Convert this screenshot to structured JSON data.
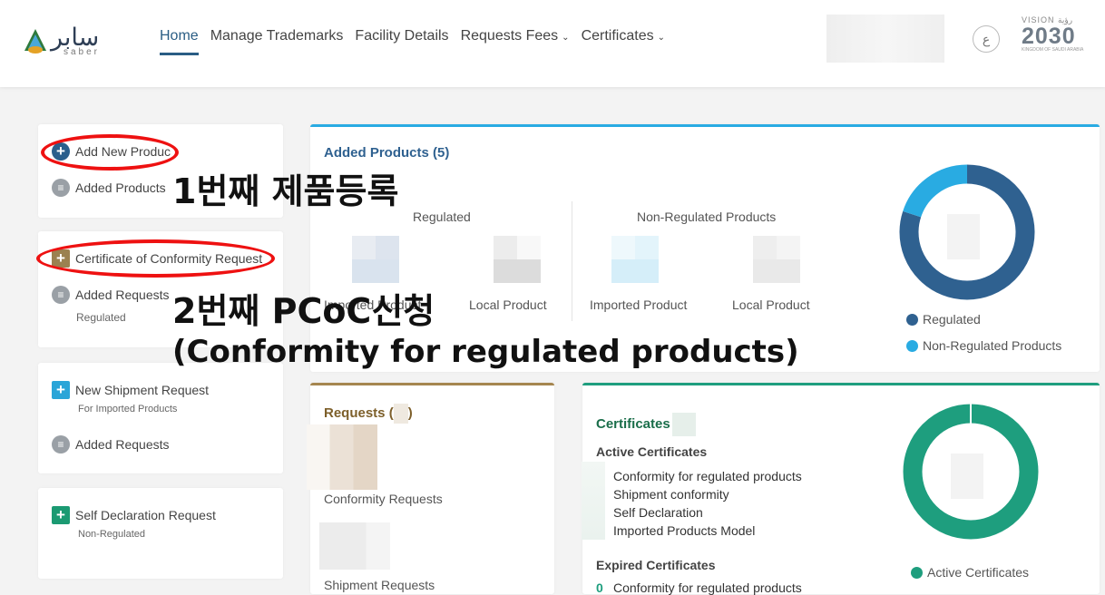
{
  "header": {
    "logo_ar": "سابر",
    "logo_en": "saber",
    "nav": [
      {
        "label": "Home",
        "active": true
      },
      {
        "label": "Manage Trademarks"
      },
      {
        "label": "Facility Details"
      },
      {
        "label": "Requests Fees",
        "dropdown": true
      },
      {
        "label": "Certificates",
        "dropdown": true
      }
    ],
    "lang_label": "ع",
    "vision": {
      "top": "VISION رؤية",
      "year": "2030",
      "bottom": "KINGDOM OF SAUDI ARABIA"
    }
  },
  "sidebar": {
    "products": {
      "add_label": "Add New Produc",
      "list_label": "Added Products"
    },
    "conformity": {
      "request_label": "Certificate of Conformity Request",
      "list_label": "Added Requests",
      "list_sub": "Regulated"
    },
    "shipment": {
      "request_label": "New Shipment Request",
      "request_sub": "For Imported Products",
      "list_label": "Added Requests"
    },
    "self_declaration": {
      "request_label": "Self Declaration Request",
      "request_sub": "Non-Regulated"
    }
  },
  "annotations": {
    "step1": "1번째 제품등록",
    "step2": "2번째 PCoC신청",
    "step2_detail": "(Conformity for regulated products)"
  },
  "added_products": {
    "title": "Added Products (5)",
    "regulated_heading": "Regulated",
    "non_regulated_heading": "Non-Regulated Products",
    "imported_label": "Imported Product",
    "local_label": "Local Product",
    "imported_label_2": "Imported Product",
    "local_label_2": "Local Product",
    "chart": {
      "regulated_color": "#2f6190",
      "non_regulated_color": "#29abe2",
      "regulated_share": 0.8,
      "non_regulated_share": 0.2
    },
    "legend_regulated": "Regulated",
    "legend_non_regulated": "Non-Regulated Products"
  },
  "requests": {
    "title": "Requests (",
    "title_close": ")",
    "conformity_label": "Conformity Requests",
    "shipment_label": "Shipment Requests"
  },
  "certificates": {
    "title": "Certificates",
    "active_heading": "Active Certificates",
    "active_items": [
      "Conformity for regulated products",
      "Shipment conformity",
      "Self Declaration",
      "Imported Products Model"
    ],
    "expired_heading": "Expired Certificates",
    "expired_count": "0",
    "expired_first": "Conformity for regulated products",
    "chart_color": "#1e9e7e",
    "legend_active": "Active Certificates"
  }
}
